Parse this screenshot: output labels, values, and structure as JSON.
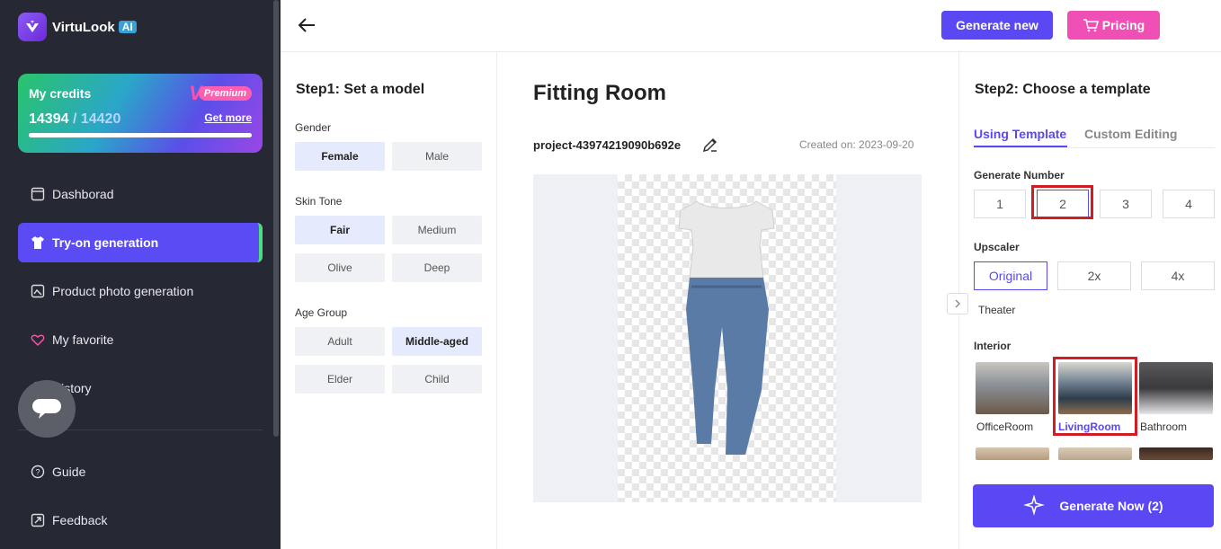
{
  "app": {
    "name": "VirtuLook",
    "badge": "AI"
  },
  "credits": {
    "title": "My credits",
    "used": "14394",
    "separator": " / ",
    "total": "14420",
    "get_more": "Get more",
    "premium": "Premium",
    "premium_mark": "V",
    "progress_fraction": 0.998
  },
  "sidebar": {
    "items": [
      {
        "label": "Dashborad"
      },
      {
        "label": "Try-on generation"
      },
      {
        "label": "Product photo generation"
      },
      {
        "label": "My favorite"
      },
      {
        "label": "History"
      },
      {
        "label": "Guide"
      },
      {
        "label": "Feedback"
      }
    ]
  },
  "header": {
    "generate_new": "Generate new",
    "pricing": "Pricing"
  },
  "step1": {
    "title": "Step1: Set a model",
    "gender": {
      "label": "Gender",
      "options": [
        "Female",
        "Male"
      ],
      "selected": "Female"
    },
    "skin": {
      "label": "Skin Tone",
      "options": [
        "Fair",
        "Medium",
        "Olive",
        "Deep"
      ],
      "selected": "Fair"
    },
    "age": {
      "label": "Age Group",
      "options": [
        "Adult",
        "Middle-aged",
        "Elder",
        "Child"
      ],
      "selected": "Middle-aged"
    }
  },
  "main": {
    "title": "Fitting Room",
    "project": "project-43974219090b692e",
    "created": "Created on:  2023-09-20"
  },
  "step2": {
    "title": "Step2: Choose a template",
    "tabs": [
      "Using Template",
      "Custom Editing"
    ],
    "gen_number": {
      "label": "Generate Number",
      "options": [
        "1",
        "2",
        "3",
        "4"
      ],
      "selected": "2"
    },
    "upscaler": {
      "label": "Upscaler",
      "options": [
        "Original",
        "2x",
        "4x"
      ],
      "selected": "Original"
    },
    "theater": "Theater",
    "interior": {
      "label": "Interior",
      "items": [
        "OfficeRoom",
        "LivingRoom",
        "Bathroom"
      ],
      "selected": "LivingRoom"
    },
    "generate_now": "Generate Now (2)"
  },
  "colors": {
    "accent": "#5a48f5",
    "pink": "#f04fb5",
    "sidebar": "#262833",
    "highlight": "#d21c24"
  }
}
